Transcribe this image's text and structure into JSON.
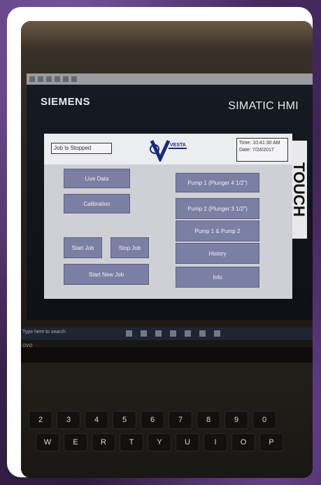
{
  "hmi": {
    "brand": "SIEMENS",
    "product": "SIMATIC HMI",
    "touch_label": "TOUCH",
    "status_text": "Job Is Stopped",
    "logo_text": "VESTA",
    "time_label": "Time:",
    "time_value": "10:41:30 AM",
    "date_label": "Date:",
    "date_value": "7/24/2017",
    "buttons": {
      "live_data": "Live Data",
      "calibration": "Calibration",
      "start_job": "Start Job",
      "stop_job": "Stop Job",
      "start_new_job": "Start New Job",
      "pump1": "Pump 1 (Plunger 4 1/2\")",
      "pump2": "Pump 2 (Plunger 3 1/2\")",
      "pump1_2": "Pump 1 & Pump 2",
      "history": "History",
      "info": "Info"
    }
  },
  "laptop": {
    "brand": "ovo",
    "search_placeholder": "Type here to search"
  },
  "keyboard": {
    "row_numbers": [
      "@",
      "2",
      "#",
      "3",
      "$",
      "4",
      "%",
      "5",
      "^",
      "6",
      "&",
      "7",
      "*",
      "8",
      "(",
      "9",
      ")",
      "0"
    ],
    "row_letters": [
      "W",
      "E",
      "R",
      "T",
      "Y",
      "U",
      "I",
      "O",
      "P"
    ]
  },
  "colors": {
    "button_fill": "#7a7fa3",
    "panel_bg": "#cfd0d6",
    "frame_border": "#ffffff",
    "surround": "#4b2d66"
  }
}
